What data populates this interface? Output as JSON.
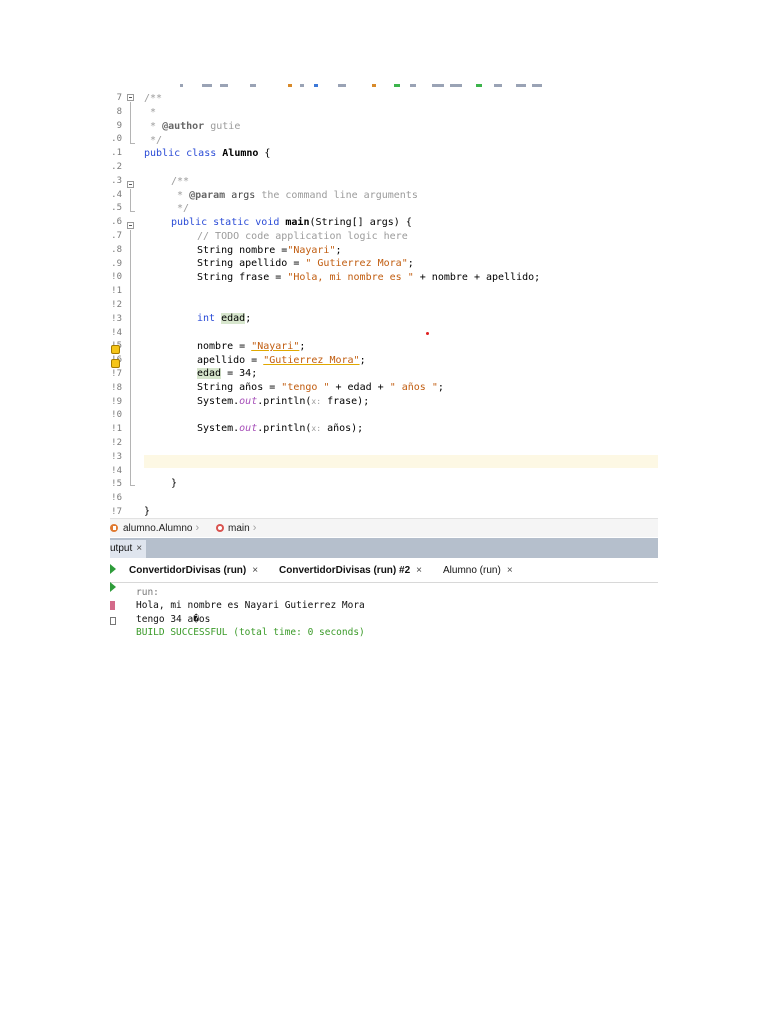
{
  "editor": {
    "line_numbers": [
      "7",
      "8",
      "9",
      ".0",
      ".1",
      ".2",
      ".3",
      ".4",
      ".5",
      ".6",
      ".7",
      ".8",
      ".9",
      "!0",
      "!1",
      "!2",
      "!3",
      "!4",
      "!5",
      "!6",
      "!7",
      "!8",
      "!9",
      "!0",
      "!1",
      "!2",
      "!3",
      "!4",
      "!5",
      "!6",
      "!7"
    ],
    "lines": {
      "l7": "/**",
      "l8": " *",
      "l9_pre": " * ",
      "l9_tag": "@author",
      "l9_post": " gutie",
      "l10": " */",
      "l11_kw": "public class ",
      "l11_name": "Alumno",
      "l11_post": " {",
      "l13": "/**",
      "l14_pre": " * ",
      "l14_tag": "@param",
      "l14_mid": " args",
      "l14_post": " the command line arguments",
      "l15": " */",
      "l16_kw": "public static void ",
      "l16_name": "main",
      "l16_post": "(String[] args) {",
      "l17": "// TODO code application logic here",
      "l18_pre": "String nombre =",
      "l18_str": "\"Nayari\"",
      "l18_post": ";",
      "l19_pre": "String apellido = ",
      "l19_str": "\" Gutierrez Mora\"",
      "l19_post": ";",
      "l20_pre": "String frase = ",
      "l20_str": "\"Hola, mi nombre es \"",
      "l20_post": " + nombre + apellido;",
      "l23_kw": "int ",
      "l23_var": "edad",
      "l23_post": ";",
      "l25_pre": "nombre = ",
      "l25_str": "\"Nayari\"",
      "l25_post": ";",
      "l26_pre": "apellido = ",
      "l26_str": "\"Gutierrez Mora\"",
      "l26_post": ";",
      "l27_var": "edad",
      "l27_post": " = 34;",
      "l28_pre": "String años = ",
      "l28_str1": "\"tengo \"",
      "l28_mid": " + edad + ",
      "l28_str2": "\" años \"",
      "l28_post": ";",
      "l29_pre": "System.",
      "l29_fld": "out",
      "l29_mid": ".println(",
      "l29_hint": "x:",
      "l29_post": " frase);",
      "l31_pre": "System.",
      "l31_fld": "out",
      "l31_mid": ".println(",
      "l31_hint": "x:",
      "l31_post": " años);",
      "l35": "}",
      "l37": "}"
    }
  },
  "breadcrumb": {
    "class_label": "alumno.Alumno",
    "method_label": "main",
    "sep": "›"
  },
  "output": {
    "panel_label": "utput",
    "close_glyph": "×",
    "tabs": [
      {
        "label": "ConvertidorDivisas (run)"
      },
      {
        "label": "ConvertidorDivisas (run) #2"
      },
      {
        "label": "Alumno (run)"
      }
    ],
    "console": [
      "run:",
      "Hola, mi nombre es Nayari Gutierrez Mora",
      "tengo 34 a�os",
      "BUILD SUCCESSFUL (total time: 0 seconds)"
    ]
  },
  "colors": {
    "keyword": "#2a4bd6",
    "comment": "#9b9b9b",
    "string": "#c15d10",
    "success": "#3a9a28",
    "output_header": "#b5bfcc"
  },
  "icons": [
    "fold-toggle-icon",
    "warning-bulb-icon",
    "class-icon",
    "method-icon",
    "run-icon",
    "stop-icon",
    "clear-icon"
  ]
}
